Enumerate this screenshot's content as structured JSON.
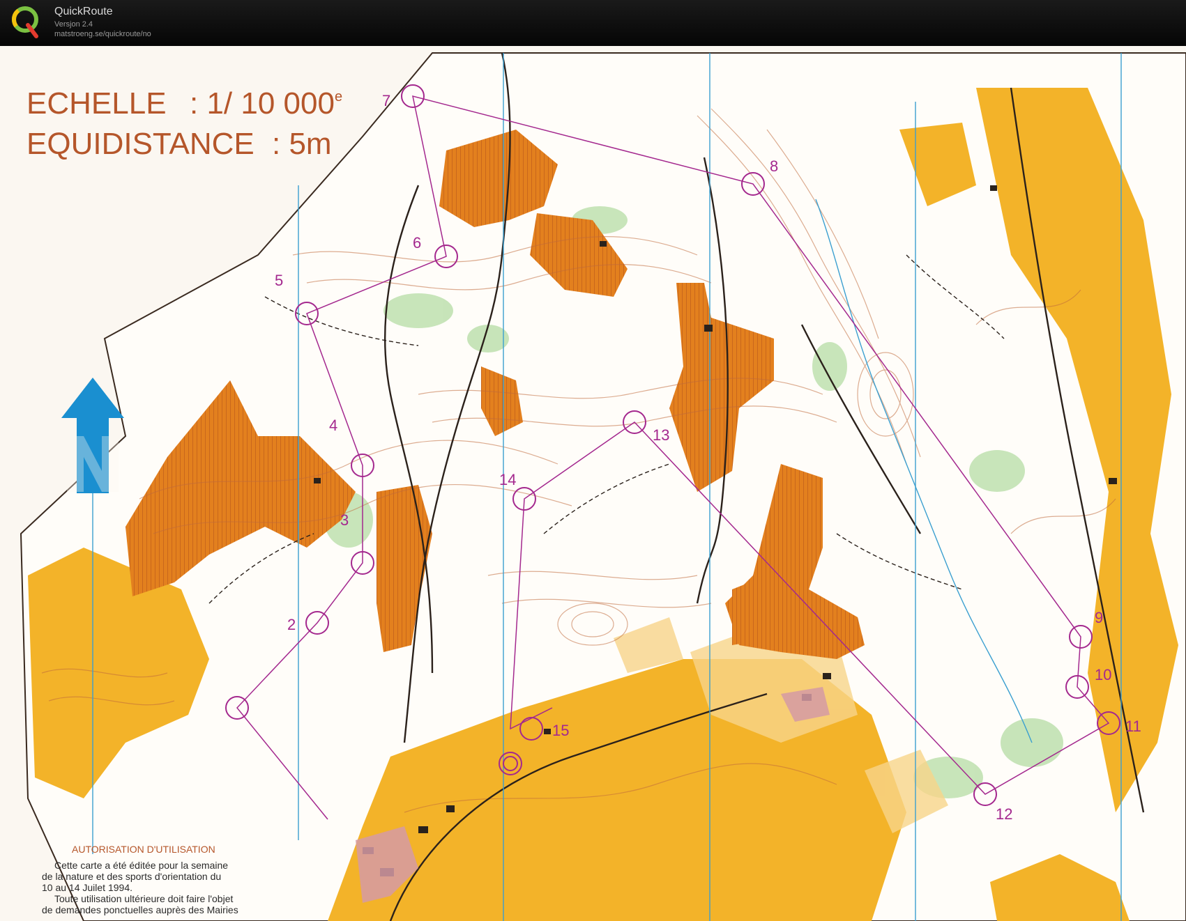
{
  "app": {
    "name": "QuickRoute",
    "version": "Versjon 2.4",
    "url": "matstroeng.se/quickroute/no"
  },
  "map": {
    "scale_label": "ECHELLE",
    "scale_value": ": 1/ 10 000",
    "scale_superscript": "e",
    "equidistance_label": "EQUIDISTANCE",
    "equidistance_value": ": 5m",
    "authorization_title": "AUTORISATION  D'UTILISATION",
    "authorization_lines": [
      "Cette carte a été éditée pour la semaine",
      "de la nature et des sports d'orientation du",
      "10 au 14 Juilet 1994.",
      "Toute utilisation ultérieure doit faire l'objet",
      "de demandes ponctuelles auprès des Mairies"
    ],
    "control_numbers": [
      "2",
      "3",
      "4",
      "5",
      "6",
      "7",
      "8",
      "9",
      "10",
      "11",
      "12",
      "13",
      "14",
      "15"
    ],
    "colors": {
      "open_land": "#f3b329",
      "rough_open": "#e3801e",
      "contour": "#b5562a",
      "course": "#a4288e",
      "magnetic_north": "#3b9fd0",
      "vegetation": "#9cd08a"
    },
    "north_arrow_icon": "north-arrow-icon"
  }
}
